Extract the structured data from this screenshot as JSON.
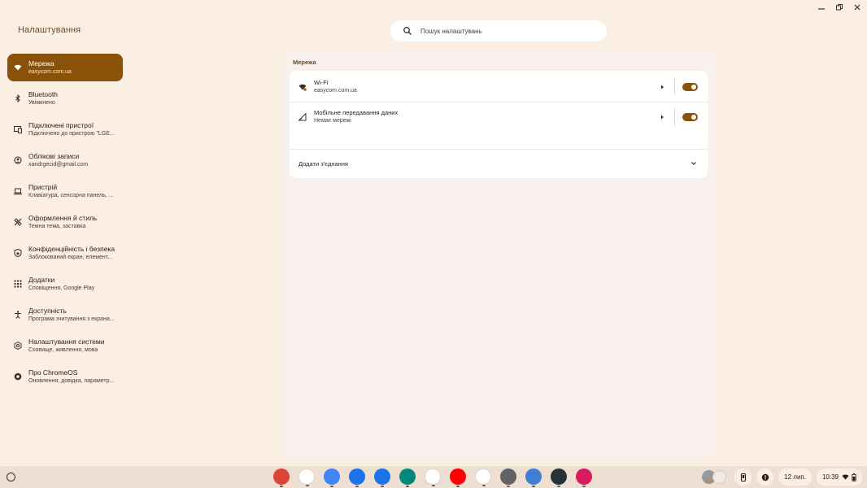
{
  "app": {
    "title": "Налаштування"
  },
  "search": {
    "placeholder": "Пошук налаштувань"
  },
  "sidebar": {
    "items": [
      {
        "label": "Мережа",
        "sub": "easycom.com.ua",
        "icon": "wifi-icon",
        "active": true
      },
      {
        "label": "Bluetooth",
        "sub": "Увімкнено",
        "icon": "bluetooth-icon"
      },
      {
        "label": "Підключені пристрої",
        "sub": "Підключено до пристрою \"LGE...",
        "icon": "connected-devices-icon"
      },
      {
        "label": "Облікові записи",
        "sub": "xandrgecid@gmail.com",
        "icon": "account-icon"
      },
      {
        "label": "Пристрій",
        "sub": "Клавіатура, сенсорна панель, ...",
        "icon": "laptop-icon"
      },
      {
        "label": "Оформлення й стиль",
        "sub": "Темна тема, заставка",
        "icon": "palette-icon"
      },
      {
        "label": "Конфіденційність і безпека",
        "sub": "Заблокований екран, елемент...",
        "icon": "shield-icon"
      },
      {
        "label": "Додатки",
        "sub": "Сповіщення, Google Play",
        "icon": "apps-grid-icon"
      },
      {
        "label": "Доступність",
        "sub": "Програма зчитування з екрана...",
        "icon": "accessibility-icon"
      },
      {
        "label": "Налаштування системи",
        "sub": "Сховище, живлення, мова",
        "icon": "system-gear-icon"
      },
      {
        "label": "Про ChromeOS",
        "sub": "Оновлення, довідка, параметр...",
        "icon": "chromeos-icon"
      }
    ]
  },
  "main": {
    "section_title": "Мережа",
    "rows": [
      {
        "label": "Wi-Fi",
        "sub": "easycom.com.ua",
        "icon": "wifi-lock-icon",
        "toggle": true
      },
      {
        "label": "Мобільне передавання даних",
        "sub": "Немає мережі",
        "icon": "cellular-icon",
        "toggle": true
      }
    ],
    "add_connection": "Додати з'єднання"
  },
  "shelf": {
    "apps": [
      {
        "name": "chrome",
        "color": "#db4437"
      },
      {
        "name": "gmail",
        "color": "#ffffff"
      },
      {
        "name": "calendar",
        "color": "#4285f4"
      },
      {
        "name": "files",
        "color": "#1a73e8"
      },
      {
        "name": "messages",
        "color": "#1a73e8"
      },
      {
        "name": "meet",
        "color": "#00897b"
      },
      {
        "name": "play-store",
        "color": "#ffffff"
      },
      {
        "name": "youtube",
        "color": "#ff0000"
      },
      {
        "name": "photos",
        "color": "#ffffff"
      },
      {
        "name": "settings",
        "color": "#5f6368"
      },
      {
        "name": "app-blue",
        "color": "#3f7fd1"
      },
      {
        "name": "app-snowflake",
        "color": "#263238"
      },
      {
        "name": "app-pink",
        "color": "#d81b60"
      }
    ],
    "date": "12 лип.",
    "time": "10:39"
  },
  "colors": {
    "accent": "#8a5108",
    "background": "#fbeee2",
    "panel": "#f7f0ec"
  }
}
